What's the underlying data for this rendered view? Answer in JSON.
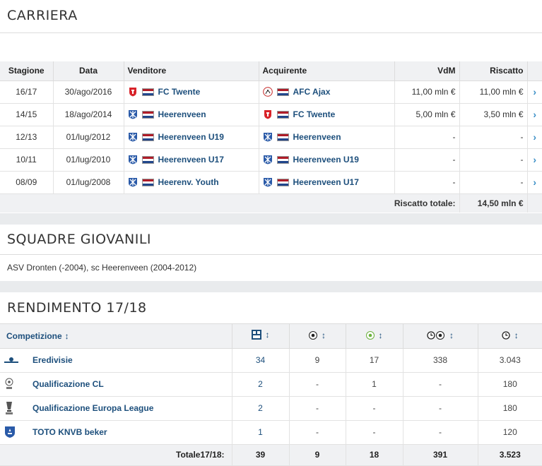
{
  "carriera": {
    "title": "CARRIERA",
    "headers": {
      "stagione": "Stagione",
      "data": "Data",
      "venditore": "Venditore",
      "acquirente": "Acquirente",
      "vdm": "VdM",
      "riscatto": "Riscatto"
    },
    "rows": [
      {
        "stagione": "16/17",
        "data": "30/ago/2016",
        "venditore": "FC Twente",
        "venditore_crest": "twente",
        "acquirente": "AFC Ajax",
        "acquirente_crest": "ajax",
        "vdm": "11,00 mln €",
        "riscatto": "11,00 mln €"
      },
      {
        "stagione": "14/15",
        "data": "18/ago/2014",
        "venditore": "Heerenveen",
        "venditore_crest": "heerenveen",
        "acquirente": "FC Twente",
        "acquirente_crest": "twente",
        "vdm": "5,00 mln €",
        "riscatto": "3,50 mln €"
      },
      {
        "stagione": "12/13",
        "data": "01/lug/2012",
        "venditore": "Heerenveen U19",
        "venditore_crest": "heerenveen",
        "acquirente": "Heerenveen",
        "acquirente_crest": "heerenveen",
        "vdm": "-",
        "riscatto": "-"
      },
      {
        "stagione": "10/11",
        "data": "01/lug/2010",
        "venditore": "Heerenveen U17",
        "venditore_crest": "heerenveen",
        "acquirente": "Heerenveen U19",
        "acquirente_crest": "heerenveen",
        "vdm": "-",
        "riscatto": "-"
      },
      {
        "stagione": "08/09",
        "data": "01/lug/2008",
        "venditore": "Heerenv. Youth",
        "venditore_crest": "heerenveen",
        "acquirente": "Heerenveen U17",
        "acquirente_crest": "heerenveen",
        "vdm": "-",
        "riscatto": "-"
      }
    ],
    "total_label": "Riscatto totale:",
    "total_value": "14,50 mln €"
  },
  "giovanili": {
    "title": "SQUADRE GIOVANILI",
    "text": "ASV Dronten (-2004), sc Heerenveen (2004-2012)"
  },
  "rendimento": {
    "title": "RENDIMENTO 17/18",
    "headers": {
      "competizione": "Competizione",
      "icons": [
        "appearances-icon",
        "goals-icon",
        "assists-icon",
        "minutes-per-goal-icon",
        "minutes-icon"
      ]
    },
    "rows": [
      {
        "name": "Eredivisie",
        "icon": "eredivisie-logo",
        "presenze": "34",
        "gol": "9",
        "assist": "17",
        "min_gol": "338",
        "minuti": "3.043"
      },
      {
        "name": "Qualificazione CL",
        "icon": "champions-league-logo",
        "presenze": "2",
        "gol": "-",
        "assist": "1",
        "min_gol": "-",
        "minuti": "180"
      },
      {
        "name": "Qualificazione Europa League",
        "icon": "europa-league-logo",
        "presenze": "2",
        "gol": "-",
        "assist": "-",
        "min_gol": "-",
        "minuti": "180"
      },
      {
        "name": "TOTO KNVB beker",
        "icon": "knvb-beker-logo",
        "presenze": "1",
        "gol": "-",
        "assist": "-",
        "min_gol": "-",
        "minuti": "120"
      }
    ],
    "total": {
      "label": "Totale17/18:",
      "presenze": "39",
      "gol": "9",
      "assist": "18",
      "min_gol": "391",
      "minuti": "3.523"
    }
  },
  "colors": {
    "link": "#1d4f7c",
    "header_bg": "#f0f1f3",
    "chevron": "#3a8fc7",
    "twente_red": "#d8232a",
    "heerenveen_blue": "#2a5aa8"
  }
}
